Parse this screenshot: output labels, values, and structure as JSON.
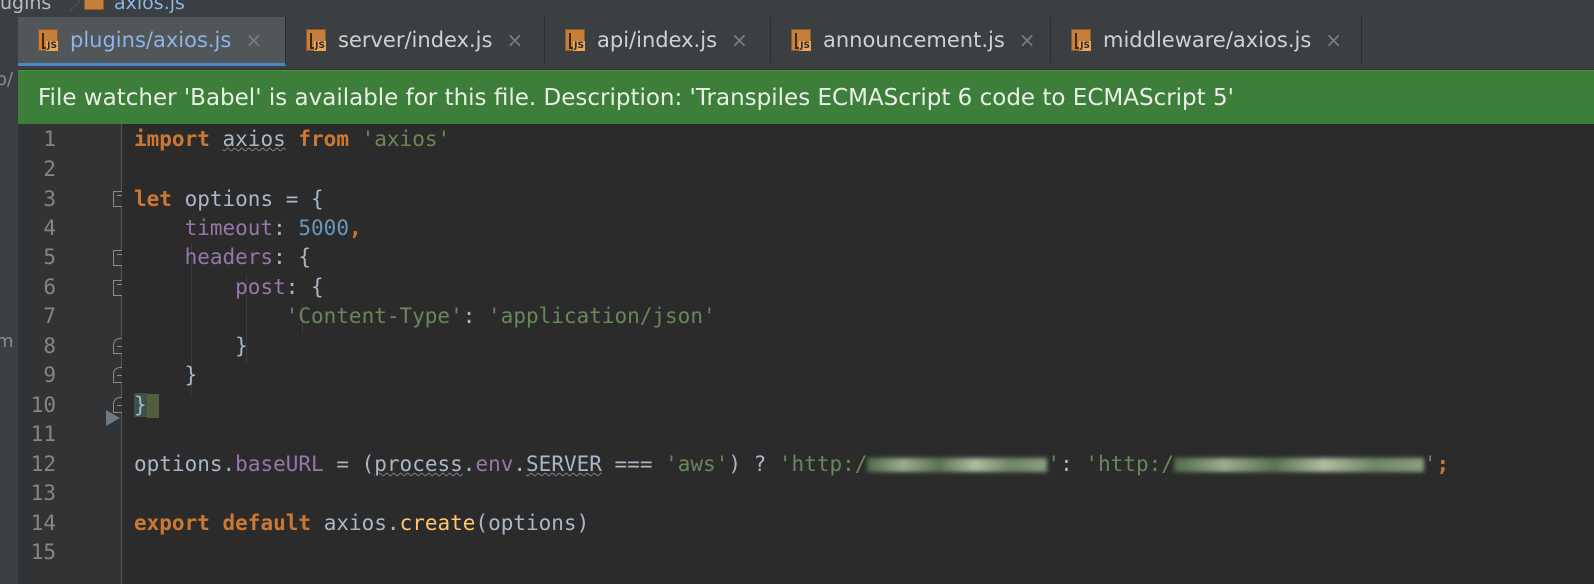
{
  "breadcrumb": {
    "first": "ugins",
    "second": "axios.js"
  },
  "left_strip": {
    "fragments": [
      "o/",
      "m"
    ]
  },
  "tabs": [
    {
      "label": "plugins/axios.js",
      "active": true
    },
    {
      "label": "server/index.js",
      "active": false
    },
    {
      "label": "api/index.js",
      "active": false
    },
    {
      "label": "announcement.js",
      "active": false
    },
    {
      "label": "middleware/axios.js",
      "active": false
    }
  ],
  "tab_close_glyph": "×",
  "file_icon_label": "JS",
  "banner": {
    "text": "File watcher 'Babel' is available for this file. Description: 'Transpiles ECMAScript 6 code to ECMAScript 5'"
  },
  "line_numbers": [
    "1",
    "2",
    "3",
    "4",
    "5",
    "6",
    "7",
    "8",
    "9",
    "10",
    "11",
    "12",
    "13",
    "14",
    "15"
  ],
  "code": {
    "l1_import": "import",
    "l1_axios": "axios",
    "l1_from": "from",
    "l1_str": "'axios'",
    "l3_let": "let",
    "l3_rest": " options = {",
    "l4_key": "timeout",
    "l4_colon": ": ",
    "l4_num": "5000",
    "l4_comma": ",",
    "l5_key": "headers",
    "l5_rest": ": {",
    "l6_key": "post",
    "l6_rest": ": {",
    "l7_key": "'Content-Type'",
    "l7_colon": ": ",
    "l7_val": "'application/json'",
    "l8_brace": "}",
    "l9_brace": "}",
    "l10_brace": "}",
    "l12_options": "options",
    "l12_dot1": ".",
    "l12_baseURL": "baseURL",
    "l12_eq": " = (",
    "l12_process": "process",
    "l12_dot2": ".",
    "l12_env": "env",
    "l12_dot3": ".",
    "l12_server": "SERVER",
    "l12_cmp": " === ",
    "l12_aws": "'aws'",
    "l12_tern": ") ? ",
    "l12_http1": "'http:/",
    "l12_q1": "'",
    "l12_colon": ": ",
    "l12_http2": "'http:/",
    "l12_q2": "'",
    "l12_semi": ";",
    "l14_export": "export",
    "l14_default": "default",
    "l14_axios": "axios",
    "l14_dot": ".",
    "l14_create": "create",
    "l14_rest": "(options)"
  },
  "colors": {
    "keyword": "#cc7832",
    "string": "#6a8759",
    "number": "#6897bb",
    "property": "#9876aa",
    "function": "#ffc66d",
    "banner_bg": "#3d7e3a",
    "active_tab_text": "#8cb4e8"
  },
  "icons": {
    "file": "javascript-file-icon",
    "close": "close-icon",
    "fold": "fold-marker-icon"
  }
}
